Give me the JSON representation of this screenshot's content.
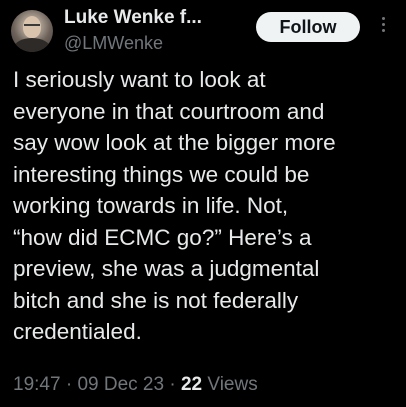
{
  "author": {
    "display_name": "Luke Wenke f...",
    "handle": "@LMWenke"
  },
  "follow_button": {
    "label": "Follow"
  },
  "more_icon": "vertical-ellipsis",
  "tweet": {
    "text": "I seriously want to look at\neveryone in that courtroom and\nsay wow look at the bigger more\ninteresting things we could be\nworking towards in life.  Not,\n“how did ECMC go?”  Here’s a\npreview, she was a judgmental\nbitch and she is not federally\ncredentialed."
  },
  "meta": {
    "time": "19:47",
    "sep1": " · ",
    "date": "09 Dec 23",
    "sep2": " · ",
    "views_count": "22",
    "views_label": " Views"
  },
  "colors": {
    "background": "#000000",
    "primary_text": "#e7e9ea",
    "secondary_text": "#71767b",
    "button_bg": "#eff3f4"
  }
}
